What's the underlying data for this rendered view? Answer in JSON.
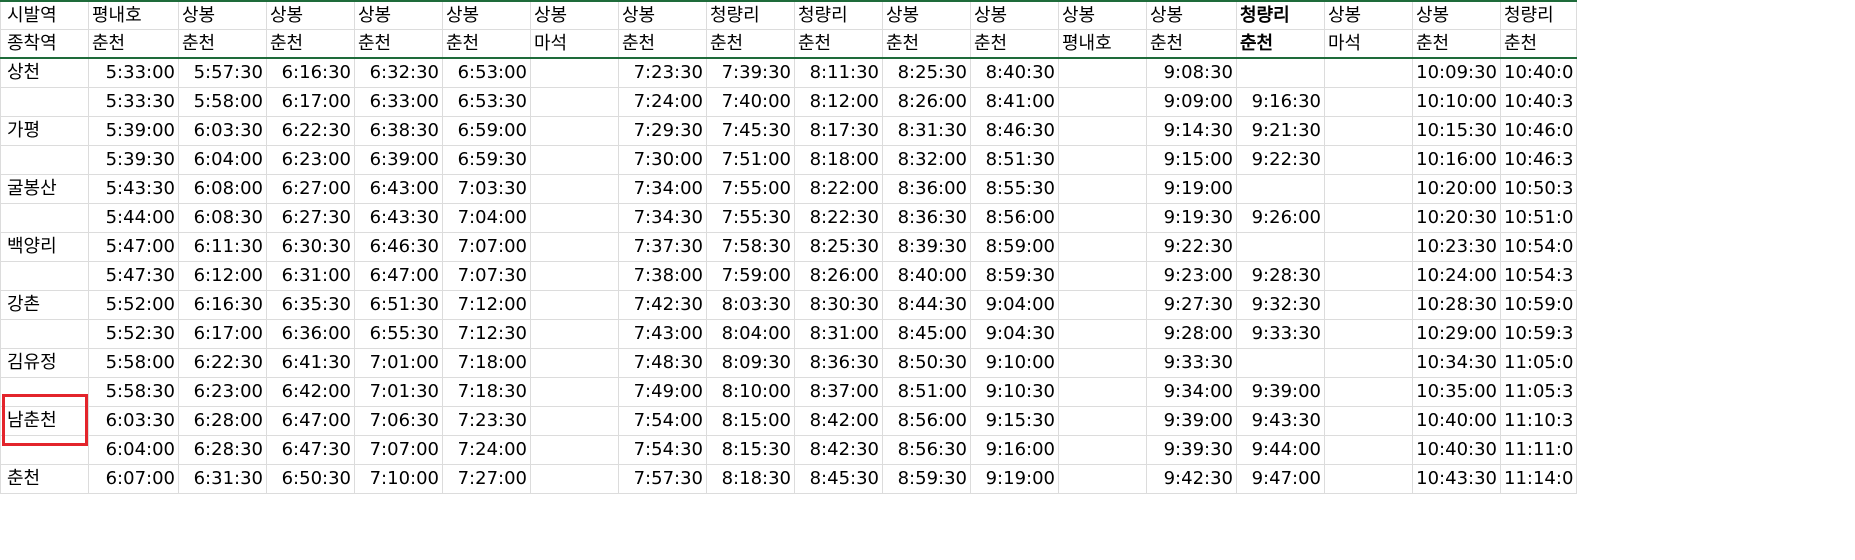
{
  "header": {
    "departure_label": "시발역",
    "arrival_label": "종착역",
    "departures": [
      "평내호",
      "상봉",
      "상봉",
      "상봉",
      "상봉",
      "상봉",
      "상봉",
      "청량리",
      "청량리",
      "상봉",
      "상봉",
      "상봉",
      "상봉",
      "청량리",
      "상봉",
      "상봉",
      "청량리"
    ],
    "arrivals": [
      "춘천",
      "춘천",
      "춘천",
      "춘천",
      "춘천",
      "마석",
      "춘천",
      "춘천",
      "춘천",
      "춘천",
      "춘천",
      "평내호",
      "춘천",
      "춘천",
      "마석",
      "춘천",
      "춘천"
    ],
    "bold_column_index": 13
  },
  "rows": [
    {
      "station": "상천",
      "times": [
        "5:33:00",
        "5:57:30",
        "6:16:30",
        "6:32:30",
        "6:53:00",
        "",
        "7:23:30",
        "7:39:30",
        "8:11:30",
        "8:25:30",
        "8:40:30",
        "",
        "9:08:30",
        "",
        "",
        "10:09:30",
        "10:40:0"
      ]
    },
    {
      "station": "",
      "times": [
        "5:33:30",
        "5:58:00",
        "6:17:00",
        "6:33:00",
        "6:53:30",
        "",
        "7:24:00",
        "7:40:00",
        "8:12:00",
        "8:26:00",
        "8:41:00",
        "",
        "9:09:00",
        "9:16:30",
        "",
        "10:10:00",
        "10:40:3"
      ]
    },
    {
      "station": "가평",
      "times": [
        "5:39:00",
        "6:03:30",
        "6:22:30",
        "6:38:30",
        "6:59:00",
        "",
        "7:29:30",
        "7:45:30",
        "8:17:30",
        "8:31:30",
        "8:46:30",
        "",
        "9:14:30",
        "9:21:30",
        "",
        "10:15:30",
        "10:46:0"
      ]
    },
    {
      "station": "",
      "times": [
        "5:39:30",
        "6:04:00",
        "6:23:00",
        "6:39:00",
        "6:59:30",
        "",
        "7:30:00",
        "7:51:00",
        "8:18:00",
        "8:32:00",
        "8:51:30",
        "",
        "9:15:00",
        "9:22:30",
        "",
        "10:16:00",
        "10:46:3"
      ]
    },
    {
      "station": "굴봉산",
      "times": [
        "5:43:30",
        "6:08:00",
        "6:27:00",
        "6:43:00",
        "7:03:30",
        "",
        "7:34:00",
        "7:55:00",
        "8:22:00",
        "8:36:00",
        "8:55:30",
        "",
        "9:19:00",
        "",
        "",
        "10:20:00",
        "10:50:3"
      ]
    },
    {
      "station": "",
      "times": [
        "5:44:00",
        "6:08:30",
        "6:27:30",
        "6:43:30",
        "7:04:00",
        "",
        "7:34:30",
        "7:55:30",
        "8:22:30",
        "8:36:30",
        "8:56:00",
        "",
        "9:19:30",
        "9:26:00",
        "",
        "10:20:30",
        "10:51:0"
      ]
    },
    {
      "station": "백양리",
      "times": [
        "5:47:00",
        "6:11:30",
        "6:30:30",
        "6:46:30",
        "7:07:00",
        "",
        "7:37:30",
        "7:58:30",
        "8:25:30",
        "8:39:30",
        "8:59:00",
        "",
        "9:22:30",
        "",
        "",
        "10:23:30",
        "10:54:0"
      ]
    },
    {
      "station": "",
      "times": [
        "5:47:30",
        "6:12:00",
        "6:31:00",
        "6:47:00",
        "7:07:30",
        "",
        "7:38:00",
        "7:59:00",
        "8:26:00",
        "8:40:00",
        "8:59:30",
        "",
        "9:23:00",
        "9:28:30",
        "",
        "10:24:00",
        "10:54:3"
      ]
    },
    {
      "station": "강촌",
      "times": [
        "5:52:00",
        "6:16:30",
        "6:35:30",
        "6:51:30",
        "7:12:00",
        "",
        "7:42:30",
        "8:03:30",
        "8:30:30",
        "8:44:30",
        "9:04:00",
        "",
        "9:27:30",
        "9:32:30",
        "",
        "10:28:30",
        "10:59:0"
      ]
    },
    {
      "station": "",
      "times": [
        "5:52:30",
        "6:17:00",
        "6:36:00",
        "6:55:30",
        "7:12:30",
        "",
        "7:43:00",
        "8:04:00",
        "8:31:00",
        "8:45:00",
        "9:04:30",
        "",
        "9:28:00",
        "9:33:30",
        "",
        "10:29:00",
        "10:59:3"
      ]
    },
    {
      "station": "김유정",
      "times": [
        "5:58:00",
        "6:22:30",
        "6:41:30",
        "7:01:00",
        "7:18:00",
        "",
        "7:48:30",
        "8:09:30",
        "8:36:30",
        "8:50:30",
        "9:10:00",
        "",
        "9:33:30",
        "",
        "",
        "10:34:30",
        "11:05:0"
      ]
    },
    {
      "station": "",
      "times": [
        "5:58:30",
        "6:23:00",
        "6:42:00",
        "7:01:30",
        "7:18:30",
        "",
        "7:49:00",
        "8:10:00",
        "8:37:00",
        "8:51:00",
        "9:10:30",
        "",
        "9:34:00",
        "9:39:00",
        "",
        "10:35:00",
        "11:05:3"
      ]
    },
    {
      "station": "남춘천",
      "times": [
        "6:03:30",
        "6:28:00",
        "6:47:00",
        "7:06:30",
        "7:23:30",
        "",
        "7:54:00",
        "8:15:00",
        "8:42:00",
        "8:56:00",
        "9:15:30",
        "",
        "9:39:00",
        "9:43:30",
        "",
        "10:40:00",
        "11:10:3"
      ]
    },
    {
      "station": "",
      "times": [
        "6:04:00",
        "6:28:30",
        "6:47:30",
        "7:07:00",
        "7:24:00",
        "",
        "7:54:30",
        "8:15:30",
        "8:42:30",
        "8:56:30",
        "9:16:00",
        "",
        "9:39:30",
        "9:44:00",
        "",
        "10:40:30",
        "11:11:0"
      ]
    },
    {
      "station": "춘천",
      "times": [
        "6:07:00",
        "6:31:30",
        "6:50:30",
        "7:10:00",
        "7:27:00",
        "",
        "7:57:30",
        "8:18:30",
        "8:45:30",
        "8:59:30",
        "9:19:00",
        "",
        "9:42:30",
        "9:47:00",
        "",
        "10:43:30",
        "11:14:0"
      ]
    }
  ],
  "highlight": {
    "station": "남춘천",
    "color": "#e3242b"
  },
  "colors": {
    "grid": "#dcdcdc",
    "header_border": "#1e6b3a"
  }
}
